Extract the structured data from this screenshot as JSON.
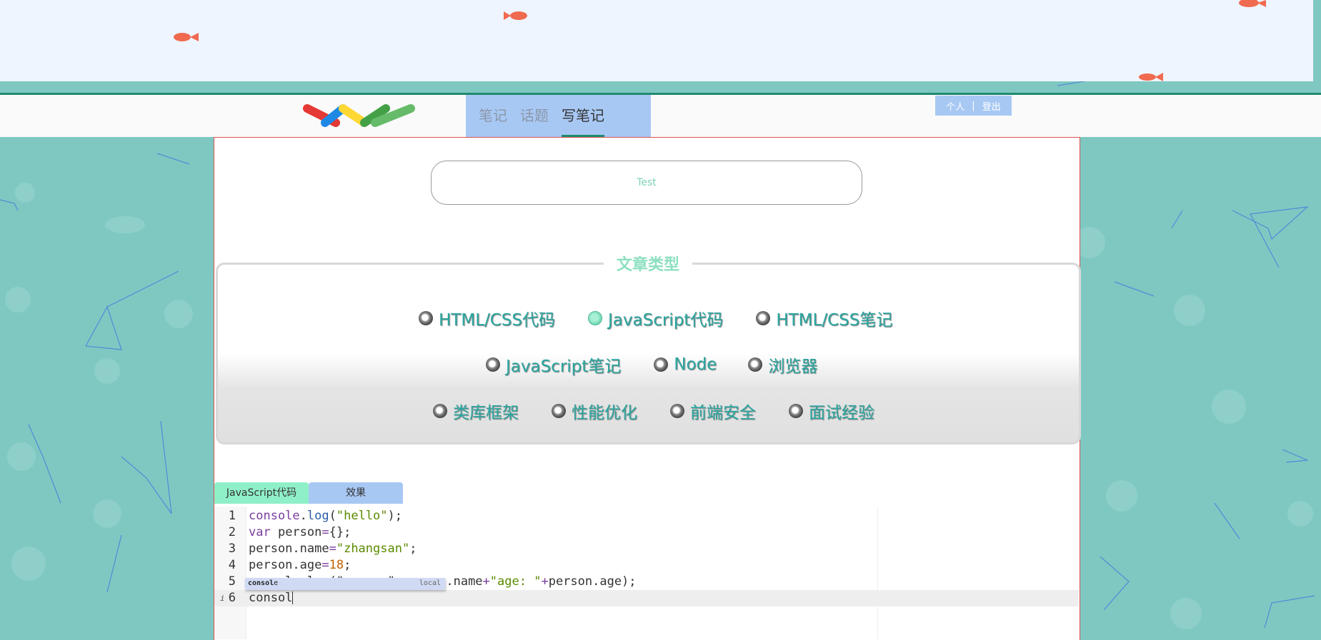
{
  "nav": {
    "tabs": [
      {
        "label": "笔记"
      },
      {
        "label": "话题"
      },
      {
        "label": "写笔记",
        "active": true
      }
    ],
    "user_links": [
      "个人",
      "|",
      "登出"
    ]
  },
  "title_input": {
    "value": "Test"
  },
  "article_types": {
    "legend": "文章类型",
    "rows": [
      [
        {
          "label": "HTML/CSS代码",
          "checked": false
        },
        {
          "label": "JavaScript代码",
          "checked": true
        },
        {
          "label": "HTML/CSS笔记",
          "checked": false
        }
      ],
      [
        {
          "label": "JavaScript笔记",
          "checked": false
        },
        {
          "label": "Node",
          "checked": false
        },
        {
          "label": "浏览器",
          "checked": false
        }
      ],
      [
        {
          "label": "类库框架",
          "checked": false
        },
        {
          "label": "性能优化",
          "checked": false
        },
        {
          "label": "前端安全",
          "checked": false
        },
        {
          "label": "面试经验",
          "checked": false
        }
      ]
    ]
  },
  "code_tabs": [
    {
      "label": "JavaScript代码"
    },
    {
      "label": "效果"
    }
  ],
  "editor": {
    "line_numbers": [
      "1",
      "2",
      "3",
      "4",
      "5",
      "6"
    ],
    "lines": [
      [
        {
          "t": "console",
          "c": "kw"
        },
        {
          "t": ".",
          "c": ""
        },
        {
          "t": "log",
          "c": "fn"
        },
        {
          "t": "(",
          "c": ""
        },
        {
          "t": "\"hello\"",
          "c": "str"
        },
        {
          "t": ");",
          "c": ""
        }
      ],
      [
        {
          "t": "var",
          "c": "kw"
        },
        {
          "t": " person",
          "c": ""
        },
        {
          "t": "=",
          "c": "op"
        },
        {
          "t": "{};",
          "c": ""
        }
      ],
      [
        {
          "t": "person.name",
          "c": ""
        },
        {
          "t": "=",
          "c": "op"
        },
        {
          "t": "\"zhangsan\"",
          "c": "str"
        },
        {
          "t": ";",
          "c": ""
        }
      ],
      [
        {
          "t": "person.age",
          "c": ""
        },
        {
          "t": "=",
          "c": "op"
        },
        {
          "t": "18",
          "c": "num"
        },
        {
          "t": ";",
          "c": ""
        }
      ],
      [
        {
          "t": "console.log(\"name: \"",
          "c": ""
        },
        {
          "t": "+",
          "c": "op"
        },
        {
          "t": "person.name",
          "c": ""
        },
        {
          "t": "+",
          "c": "op"
        },
        {
          "t": "\"age: \"",
          "c": "str"
        },
        {
          "t": "+",
          "c": "op"
        },
        {
          "t": "person.age);",
          "c": ""
        }
      ],
      [
        {
          "t": "consol",
          "c": ""
        }
      ]
    ],
    "hint": {
      "prefix": "consol",
      "rest": "e",
      "tag": "local"
    },
    "info_mark": "i"
  },
  "colors": {
    "accent": "#2aa6a0",
    "nav_bg": "#a8c8f4",
    "tab_green": "#8ff0c8",
    "border_red": "#d9534f"
  }
}
